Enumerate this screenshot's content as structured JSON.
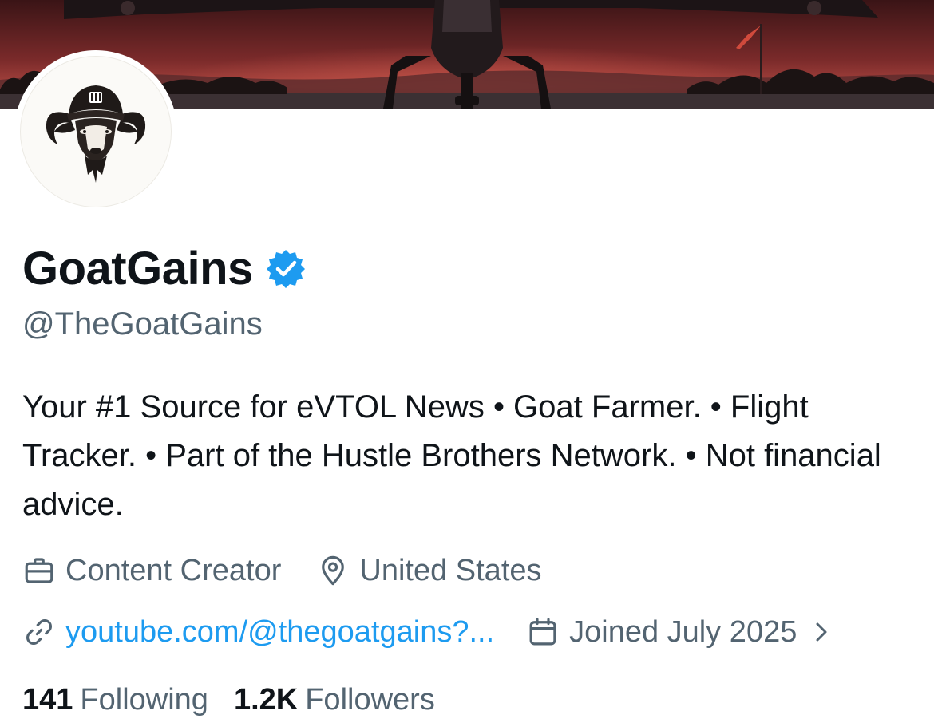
{
  "banner": {
    "description_icon": "evtol-aircraft-banner"
  },
  "profile": {
    "display_name": "GoatGains",
    "verified_icon": "verified-badge-icon",
    "handle": "@TheGoatGains",
    "bio": "Your #1 Source for eVTOL News • Goat Farmer. • Flight Tracker. • Part of the Hustle Brothers Network. • Not financial advice.",
    "category": "Content Creator",
    "location": "United States",
    "website": "youtube.com/@thegoatgains?...",
    "joined": "Joined July 2025"
  },
  "stats": {
    "following_count": "141",
    "following_label": "Following",
    "followers_count": "1.2K",
    "followers_label": "Followers"
  },
  "colors": {
    "text_primary": "#0f1419",
    "text_secondary": "#536471",
    "link": "#1d9bf0",
    "verified": "#1d9bf0"
  }
}
